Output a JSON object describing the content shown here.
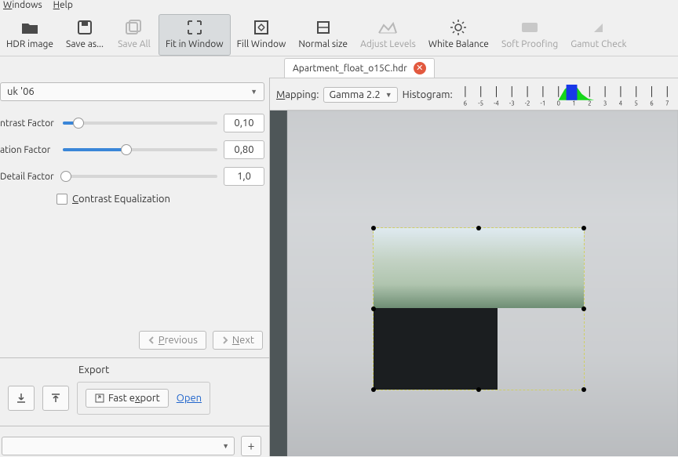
{
  "menu": {
    "windows": "Windows",
    "help": "Help"
  },
  "toolbar": {
    "hdr": "HDR image",
    "saveas": "Save as...",
    "saveall": "Save All",
    "fit": "Fit in Window",
    "fill": "Fill Window",
    "normal": "Normal size",
    "adjust": "Adjust Levels",
    "wb": "White Balance",
    "soft": "Soft Proofing",
    "gamut": "Gamut Check"
  },
  "tab": {
    "name": "Apartment_float_o15C.hdr"
  },
  "preset": "uk '06",
  "controls": {
    "contrast": {
      "label": "ntrast Factor",
      "value": "0,10",
      "pct": 10
    },
    "saturation": {
      "label": "ation Factor",
      "value": "0,80",
      "pct": 41
    },
    "detail": {
      "label": "Detail Factor",
      "value": "1,0",
      "pct": 2
    }
  },
  "check": {
    "label": "Contrast Equalization"
  },
  "nav": {
    "prev": "Previous",
    "next": "Next"
  },
  "export": {
    "header": "Export",
    "fast": "Fast export",
    "open": "Open"
  },
  "mapping": {
    "label": "Mapping:",
    "value": "Gamma 2.2",
    "hist": "Histogram:"
  },
  "ticks": [
    "6",
    "-5",
    "-4",
    "-3",
    "-2",
    "-1",
    "0",
    "1",
    "2",
    "3",
    "4",
    "5",
    "6",
    "7"
  ]
}
